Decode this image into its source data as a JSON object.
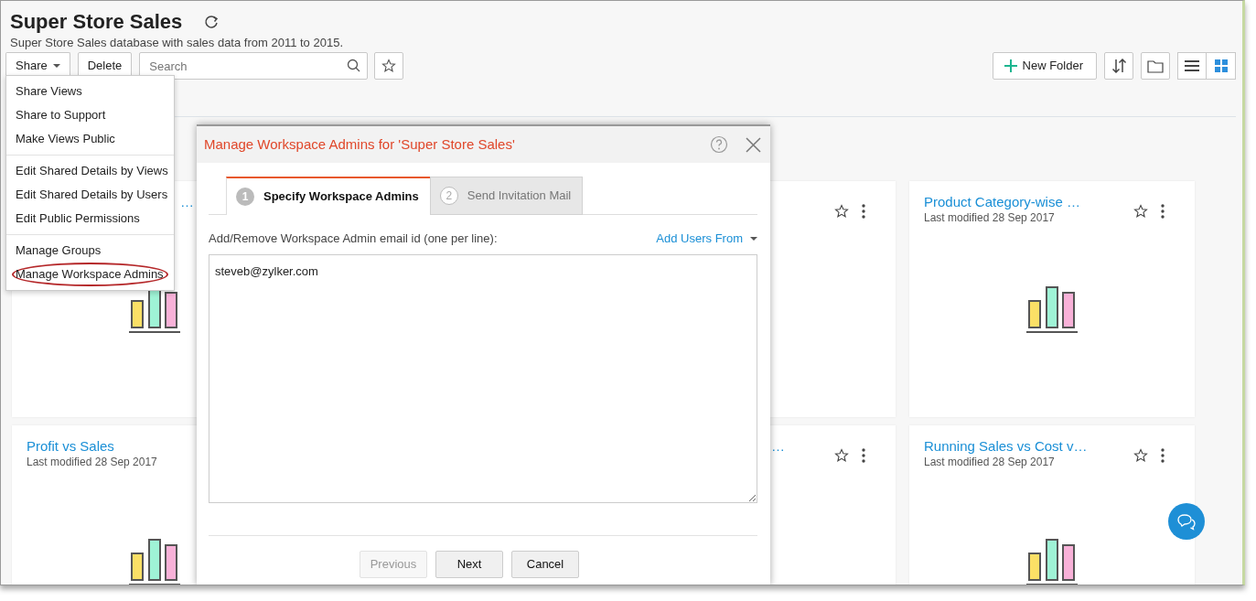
{
  "header": {
    "title": "Super Store Sales",
    "subtitle": "Super Store Sales database with sales data from 2011 to 2015."
  },
  "toolbar": {
    "share": {
      "label": "Share",
      "expanded": true
    },
    "delete": "Delete",
    "search": {
      "placeholder": "Search"
    },
    "new_folder": "New Folder",
    "views": [
      {
        "kind": "list",
        "selected": false
      },
      {
        "kind": "grid",
        "selected": true
      }
    ]
  },
  "share_menu": [
    [
      {
        "label": "Share Views",
        "highlighted": false
      },
      {
        "label": "Share to Support",
        "highlighted": false
      },
      {
        "label": "Make Views Public",
        "highlighted": false
      }
    ],
    [
      {
        "label": "Edit Shared Details by Views",
        "highlighted": false
      },
      {
        "label": "Edit Shared Details by Users",
        "highlighted": false
      },
      {
        "label": "Edit Public Permissions",
        "highlighted": false
      }
    ],
    [
      {
        "label": "Manage Groups",
        "highlighted": false
      },
      {
        "label": "Manage Workspace Admins",
        "highlighted": true
      }
    ]
  ],
  "cards": [
    {
      "title": "…",
      "actions": false,
      "chart": true
    },
    {
      "actions": true,
      "chart": false
    },
    {
      "title": "Product Category-wise …",
      "modified": "Last modified 28 Sep 2017",
      "actions": true,
      "chart": true
    },
    {
      "title": "Profit vs Sales",
      "modified": "Last modified 28 Sep 2017",
      "actions": false,
      "chart": true
    },
    {
      "title": "…",
      "actions": true,
      "chart": false
    },
    {
      "title": "Running Sales vs Cost v…",
      "modified": "Last modified 28 Sep 2017",
      "actions": true,
      "chart": true
    }
  ],
  "modal": {
    "title": "Manage Workspace Admins for 'Super Store Sales'",
    "steps": [
      {
        "number": "1",
        "label": "Specify Workspace Admins",
        "selected": true
      },
      {
        "number": "2",
        "label": "Send Invitation Mail",
        "selected": false
      }
    ],
    "field_label": "Add/Remove Workspace Admin email id (one per line):",
    "add_users": "Add Users From",
    "emails": "steveb@zylker.com",
    "buttons": [
      {
        "label": "Previous",
        "disabled": true
      },
      {
        "label": "Next",
        "disabled": false
      },
      {
        "label": "Cancel",
        "disabled": false
      }
    ]
  }
}
